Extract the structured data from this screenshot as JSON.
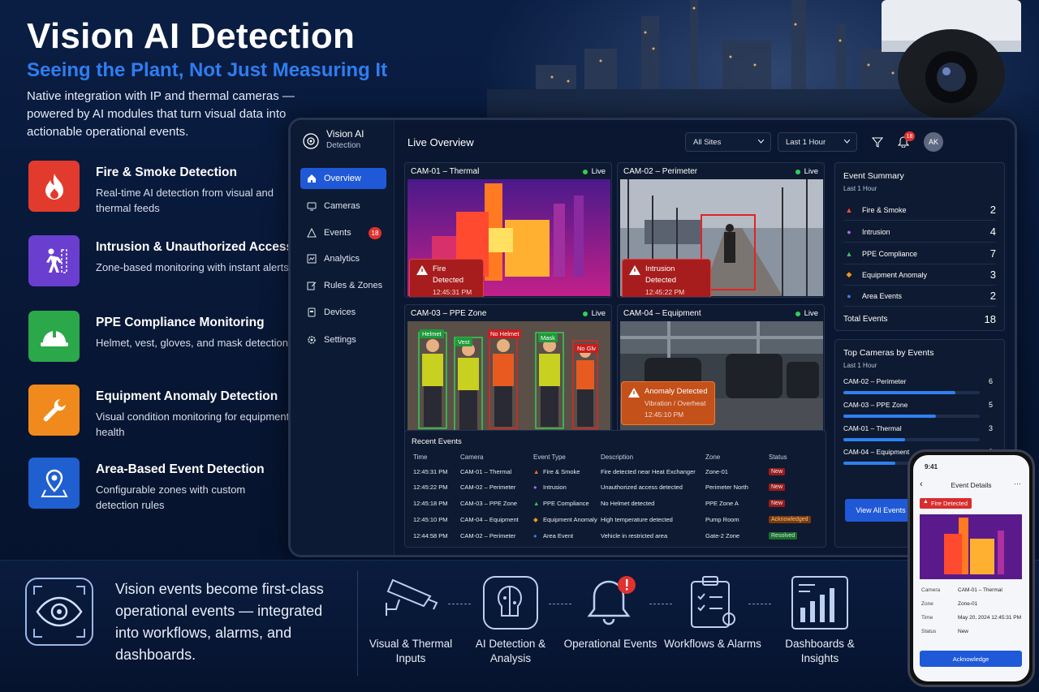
{
  "hero": {
    "title": "Vision AI Detection",
    "subtitle": "Seeing the Plant, Not Just Measuring It",
    "lead": "Native integration with IP and thermal cameras — powered by AI modules that turn visual data into actionable operational events."
  },
  "features": [
    {
      "title": "Fire & Smoke Detection",
      "desc": "Real-time AI detection from visual and thermal feeds",
      "icon": "flame-icon",
      "color": "#e23b2e"
    },
    {
      "title": "Intrusion & Unauthorized Access",
      "desc": "Zone-based monitoring with instant alerts",
      "icon": "walking-person-icon",
      "color": "#6a3fd0"
    },
    {
      "title": "PPE Compliance Monitoring",
      "desc": "Helmet, vest, gloves, and mask detection",
      "icon": "hard-hat-icon",
      "color": "#2aa84a"
    },
    {
      "title": "Equipment Anomaly Detection",
      "desc": "Visual condition monitoring for equipment health",
      "icon": "wrench-icon",
      "color": "#f08a1c"
    },
    {
      "title": "Area-Based Event Detection",
      "desc": "Configurable zones with custom detection rules",
      "icon": "location-pin-icon",
      "color": "#1f5fd0"
    }
  ],
  "app": {
    "brand_title": "Vision AI",
    "brand_sub": "Detection",
    "nav": [
      {
        "label": "Overview"
      },
      {
        "label": "Cameras"
      },
      {
        "label": "Events",
        "badge": "18"
      },
      {
        "label": "Analytics"
      },
      {
        "label": "Rules & Zones"
      },
      {
        "label": "Devices"
      },
      {
        "label": "Settings"
      }
    ],
    "page_title": "Live Overview",
    "site_select": "All Sites",
    "time_select": "Last 1 Hour",
    "notif_count": "18",
    "avatar": "AK",
    "live_label": "Live",
    "cameras": [
      {
        "name": "CAM-01 – Thermal",
        "alert": "Fire Detected",
        "time": "12:45:31 PM"
      },
      {
        "name": "CAM-02 – Perimeter",
        "alert": "Intrusion Detected",
        "time": "12:45:22 PM"
      },
      {
        "name": "CAM-03 – PPE Zone",
        "tags": [
          "Helmet",
          "Vest",
          "No Helmet",
          "Mask",
          "No Glv"
        ]
      },
      {
        "name": "CAM-04 – Equipment",
        "alert": "Anomaly Detected",
        "detail": "Vibration / Overheat",
        "time": "12:45:10 PM"
      }
    ],
    "recent": {
      "title": "Recent Events",
      "columns": [
        "Time",
        "Camera",
        "Event Type",
        "Description",
        "Zone",
        "Status"
      ],
      "rows": [
        {
          "time": "12:45:31 PM",
          "camera": "CAM-01 – Thermal",
          "type": "Fire & Smoke",
          "desc": "Fire detected near Heat Exchanger",
          "zone": "Zone-01",
          "status": "New"
        },
        {
          "time": "12:45:22 PM",
          "camera": "CAM-02 – Perimeter",
          "type": "Intrusion",
          "desc": "Unauthorized access detected",
          "zone": "Perimeter North",
          "status": "New"
        },
        {
          "time": "12:45:18 PM",
          "camera": "CAM-03 – PPE Zone",
          "type": "PPE Compliance",
          "desc": "No Helmet detected",
          "zone": "PPE Zone A",
          "status": "New"
        },
        {
          "time": "12:45:10 PM",
          "camera": "CAM-04 – Equipment",
          "type": "Equipment Anomaly",
          "desc": "High temperature detected",
          "zone": "Pump Room",
          "status": "Acknowledged"
        },
        {
          "time": "12:44:58 PM",
          "camera": "CAM-02 – Perimeter",
          "type": "Area Event",
          "desc": "Vehicle in restricted area",
          "zone": "Gate-2 Zone",
          "status": "Resolved"
        }
      ]
    },
    "summary": {
      "title": "Event Summary",
      "sub": "Last 1 Hour",
      "items": [
        {
          "label": "Fire & Smoke",
          "count": "2"
        },
        {
          "label": "Intrusion",
          "count": "4"
        },
        {
          "label": "PPE Compliance",
          "count": "7"
        },
        {
          "label": "Equipment Anomaly",
          "count": "3"
        },
        {
          "label": "Area Events",
          "count": "2"
        }
      ],
      "total_label": "Total Events",
      "total": "18"
    },
    "top_cameras": {
      "title": "Top Cameras by Events",
      "sub": "Last 1 Hour",
      "items": [
        {
          "name": "CAM-02 – Perimeter",
          "count": 6,
          "share": 0.82
        },
        {
          "name": "CAM-03 – PPE Zone",
          "count": 5,
          "share": 0.68
        },
        {
          "name": "CAM-01 – Thermal",
          "count": 3,
          "share": 0.45
        },
        {
          "name": "CAM-04 – Equipment",
          "count": 2,
          "share": 0.38
        }
      ],
      "button": "View All Events"
    }
  },
  "bottom": {
    "message": "Vision events become first-class operational events — integrated into workflows, alarms, and dashboards.",
    "flow": [
      {
        "label": "Visual & Thermal Inputs"
      },
      {
        "label": "AI Detection & Analysis"
      },
      {
        "label": "Operational Events"
      },
      {
        "label": "Workflows & Alarms"
      },
      {
        "label": "Dashboards & Insights"
      }
    ]
  },
  "phone": {
    "clock": "9:41",
    "header": "Event Details",
    "badge": "Fire Detected",
    "fields": [
      {
        "k": "Camera",
        "v": "CAM-01 – Thermal"
      },
      {
        "k": "Zone",
        "v": "Zone-01"
      },
      {
        "k": "Time",
        "v": "May 20, 2024 12:45:31 PM"
      },
      {
        "k": "Status",
        "v": "New"
      }
    ],
    "button": "Acknowledge"
  }
}
